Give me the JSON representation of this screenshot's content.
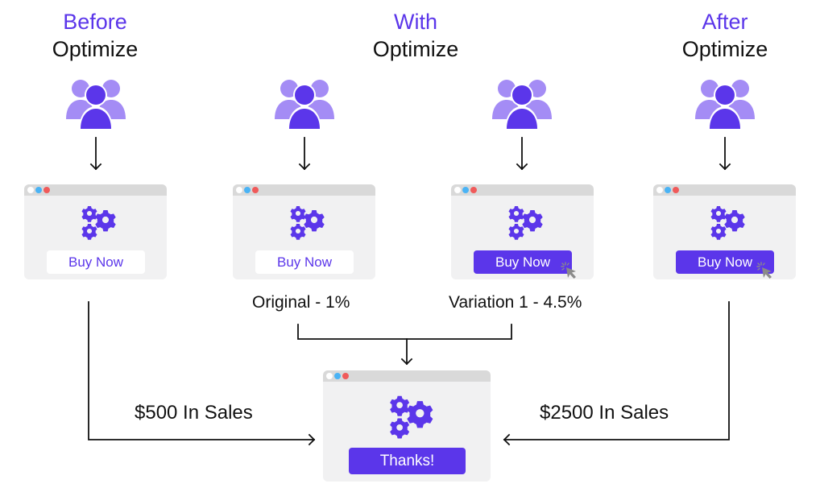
{
  "colors": {
    "accent": "#5b36ea",
    "accent_light": "#a48cf5",
    "window_bg": "#f1f1f2",
    "titlebar": "#d9d9d9",
    "dot_white": "#ffffff",
    "dot_blue": "#4ab3f5",
    "dot_red": "#f05a5a",
    "cursor": "#8a8a8a",
    "line": "#111111"
  },
  "columns": [
    {
      "accent_title": "Before",
      "title": "Optimize"
    },
    {
      "accent_title": "With",
      "title": "Optimize"
    },
    {
      "accent_title": "After",
      "title": "Optimize"
    }
  ],
  "icons": {
    "users": "users-group-icon",
    "gears": "gears-icon",
    "cursor": "click-cursor-icon"
  },
  "windows": [
    {
      "id": "before",
      "button_label": "Buy Now",
      "button_style": "outline",
      "cursor": false
    },
    {
      "id": "original",
      "button_label": "Buy Now",
      "button_style": "outline",
      "cursor": false,
      "caption": "Original - 1%"
    },
    {
      "id": "variation",
      "button_label": "Buy Now",
      "button_style": "filled",
      "cursor": true,
      "caption": "Variation 1 - 4.5%"
    },
    {
      "id": "after",
      "button_label": "Buy Now",
      "button_style": "filled",
      "cursor": true
    }
  ],
  "result_window": {
    "button_label": "Thanks!"
  },
  "sales": {
    "before": "$500 In Sales",
    "after": "$2500 In Sales"
  }
}
